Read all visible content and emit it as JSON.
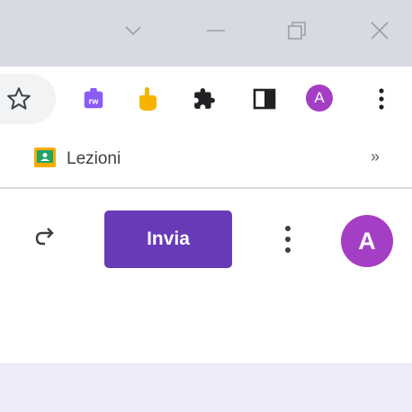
{
  "window_controls": {
    "dropdown_icon": "chevron-down-icon",
    "minimize_icon": "minimize-icon",
    "restore_icon": "restore-icon",
    "close_icon": "close-icon"
  },
  "toolbar": {
    "bookmark_icon": "star-icon",
    "extensions": [
      "rw-extension-icon",
      "hand-extension-icon",
      "puzzle-extensions-icon",
      "side-panel-icon"
    ],
    "profile_initial": "A",
    "menu_icon": "kebab-menu-icon"
  },
  "bookmarks": {
    "items": [
      {
        "label": "Lezioni",
        "icon": "classroom-icon"
      }
    ],
    "more_label": "»"
  },
  "form_header": {
    "redo_icon": "redo-icon",
    "send_label": "Invia",
    "more_icon": "kebab-menu-icon",
    "account_initial": "A"
  },
  "colors": {
    "titlebar": "#d7dae0",
    "accent_purple": "#673ab7",
    "avatar": "#a43ec4",
    "lavender": "#f0ebf8"
  }
}
